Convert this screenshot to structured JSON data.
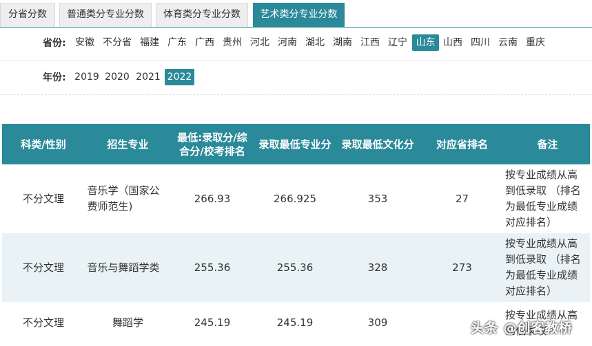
{
  "tabs": [
    {
      "label": "分省分数",
      "active": false
    },
    {
      "label": "普通类分专业分数",
      "active": false
    },
    {
      "label": "体育类分专业分数",
      "active": false
    },
    {
      "label": "艺术类分专业分数",
      "active": true
    }
  ],
  "province": {
    "label": "省份:",
    "options": [
      "安徽",
      "不分省",
      "福建",
      "广东",
      "广西",
      "贵州",
      "河北",
      "河南",
      "湖北",
      "湖南",
      "江西",
      "辽宁",
      "山东",
      "山西",
      "四川",
      "云南",
      "重庆"
    ],
    "selected": "山东"
  },
  "year": {
    "label": "年份:",
    "options": [
      "2019",
      "2020",
      "2021",
      "2022"
    ],
    "selected": "2022"
  },
  "table": {
    "columns": [
      "科类/性别",
      "招生专业",
      "最低:录取分/综合分/校考排名",
      "录取最低专业分",
      "录取最低文化分",
      "对应省排名",
      "备注"
    ],
    "rows": [
      [
        "不分文理",
        "音乐学（国家公费师范生)",
        "266.93",
        "266.925",
        "353",
        "27",
        "按专业成绩从高到低录取 （排名为最低专业成绩对应排名）"
      ],
      [
        "不分文理",
        "音乐与舞蹈学类",
        "255.36",
        "255.36",
        "328",
        "273",
        "按专业成绩从高到低录取 （排名为最低专业成绩对应排名）"
      ],
      [
        "不分文理",
        "舞蹈学",
        "245.19",
        "245.19",
        "309",
        "",
        "按专业成绩从高到低录取"
      ]
    ]
  },
  "watermark": "头条 @创客教桥",
  "colors": {
    "accent": "#2a8a99",
    "row_alt": "#e9f3f5"
  }
}
